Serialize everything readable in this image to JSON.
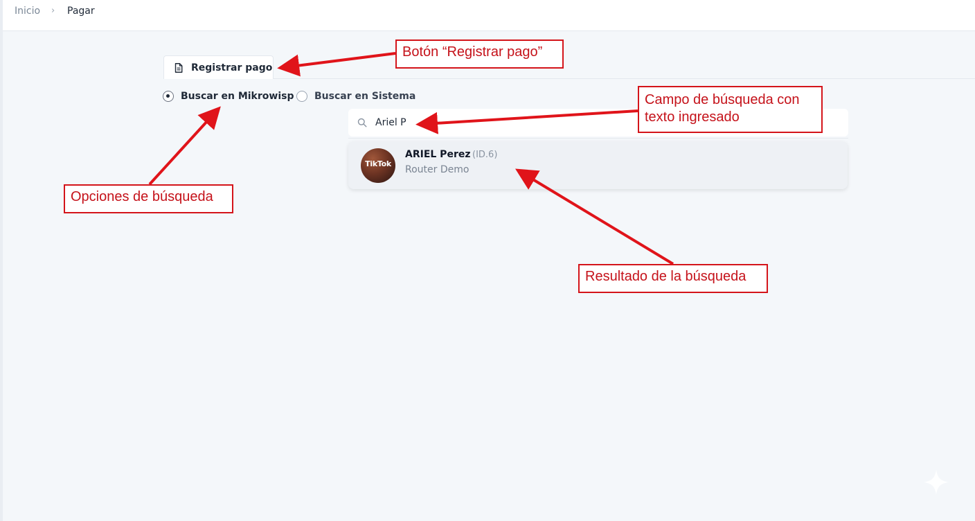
{
  "breadcrumb": {
    "home": "Inicio",
    "separator": "›",
    "current": "Pagar"
  },
  "tab": {
    "label": "Registrar pago",
    "icon": "document-icon"
  },
  "search_options": [
    {
      "label": "Buscar en Mikrowisp",
      "selected": true
    },
    {
      "label": "Buscar en Sistema",
      "selected": false
    }
  ],
  "search": {
    "value": "Ariel P",
    "icon": "search-icon"
  },
  "results": [
    {
      "name": "ARIEL Perez",
      "id": "(ID.6)",
      "subtitle": "Router Demo",
      "avatar_text": "TikTok"
    }
  ],
  "annotations": {
    "button": "Botón “Registrar pago”",
    "search_field": "Campo de búsqueda con texto ingresado",
    "search_options": "Opciones de búsqueda",
    "result": "Resultado de la búsqueda"
  },
  "colors": {
    "annotation_red": "#d4141a",
    "background": "#f4f7fa",
    "result_card": "#eef1f5"
  }
}
